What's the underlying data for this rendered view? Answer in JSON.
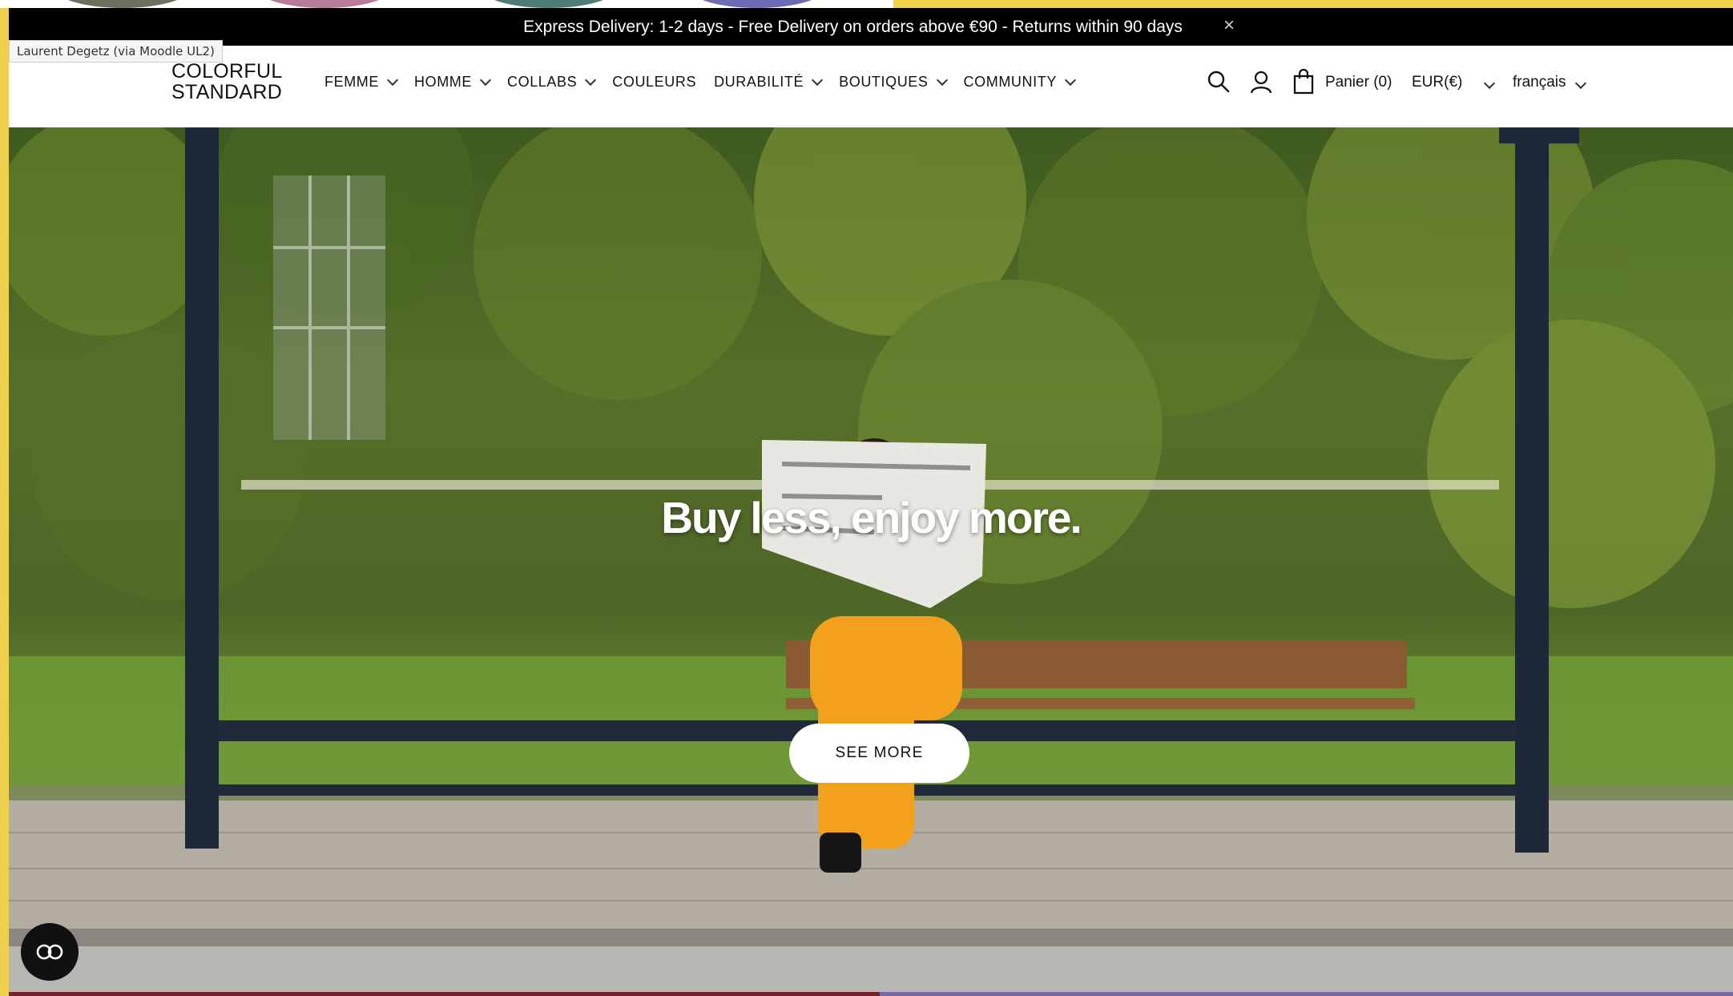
{
  "announcement": {
    "text": "Express Delivery: 1-2 days - Free Delivery on orders above €90 - Returns within 90 days",
    "close_symbol": "×"
  },
  "tooltip": {
    "text": "Laurent Degetz (via Moodle UL2)"
  },
  "brand": {
    "line1": "COLORFUL",
    "line2": "STANDARD"
  },
  "nav": {
    "items": [
      {
        "label": "FEMME",
        "has_dropdown": true
      },
      {
        "label": "HOMME",
        "has_dropdown": true
      },
      {
        "label": "COLLABS",
        "has_dropdown": true
      },
      {
        "label": "COULEURS",
        "has_dropdown": false
      },
      {
        "label": "DURABILITÉ",
        "has_dropdown": true
      },
      {
        "label": "BOUTIQUES",
        "has_dropdown": true
      },
      {
        "label": "COMMUNITY",
        "has_dropdown": true
      }
    ]
  },
  "tools": {
    "cart_label": "Panier (0)",
    "currency": "EUR(€)",
    "language": "français",
    "icons": [
      "search-icon",
      "account-icon",
      "bag-icon"
    ]
  },
  "hero": {
    "headline": "Buy less, enjoy more.",
    "cta_label": "SEE MORE"
  },
  "colors": {
    "announcement_bg": "#000000",
    "accent_frame": "#efd04e",
    "bottom_left": "#7a1f2a",
    "bottom_right": "#7766a8"
  }
}
